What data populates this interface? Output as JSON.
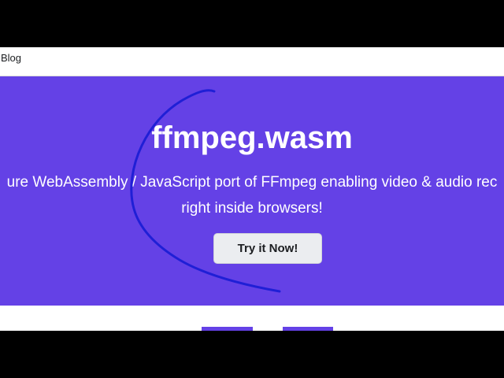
{
  "header": {
    "nav_blog": "Blog"
  },
  "hero": {
    "title": "ffmpeg.wasm",
    "subtitle_line1": "ure WebAssembly / JavaScript port of FFmpeg enabling video & audio rec",
    "subtitle_line2": "right inside browsers!",
    "cta_label": "Try it Now!"
  },
  "colors": {
    "hero_bg": "#6441e6",
    "annotation_stroke": "#1f1fd6",
    "letterbox": "#000000"
  }
}
